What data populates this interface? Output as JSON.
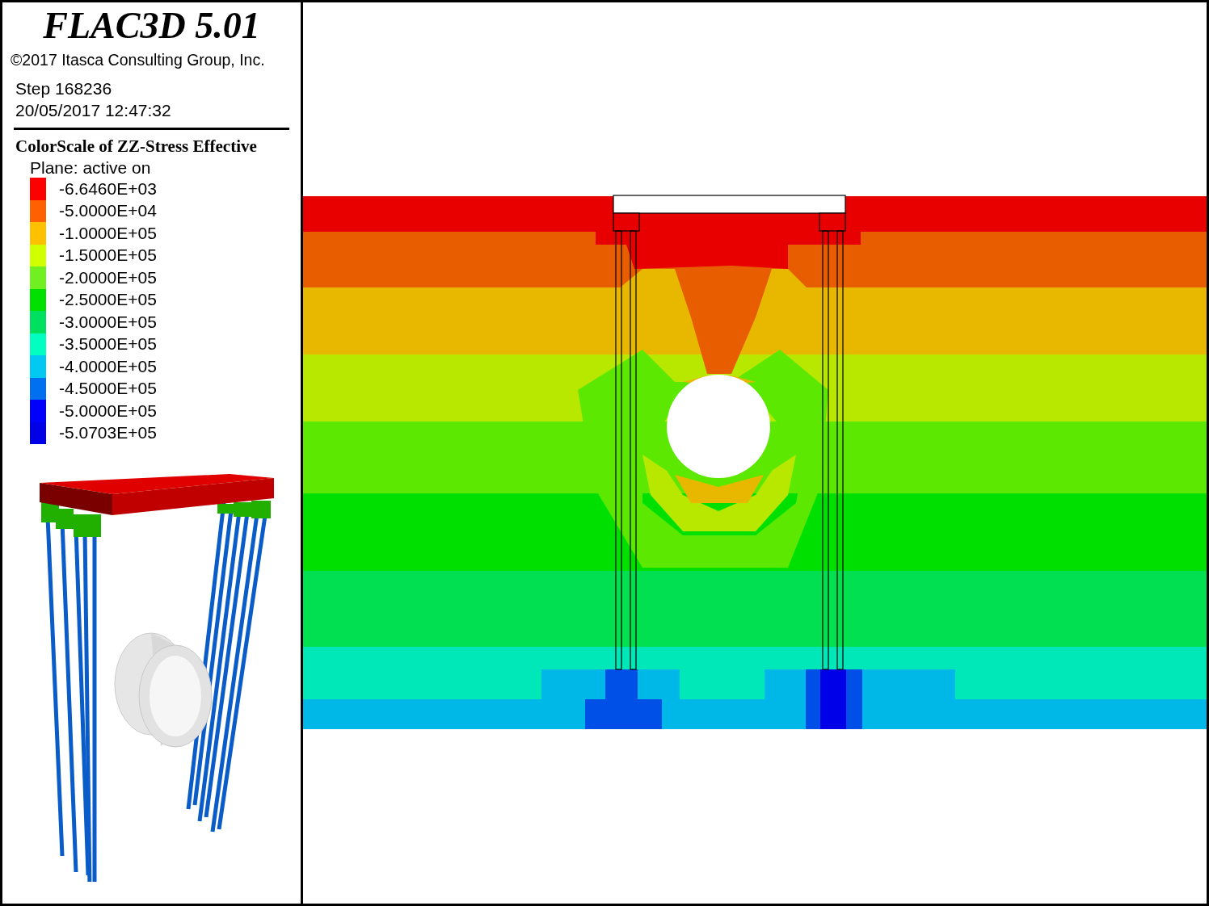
{
  "header": {
    "title": "FLAC3D 5.01",
    "copyright": "©2017 Itasca Consulting Group, Inc.",
    "step": "Step 168236",
    "timestamp": "20/05/2017 12:47:32"
  },
  "legend": {
    "title": "ColorScale of ZZ-Stress Effective",
    "subtitle": "Plane: active on",
    "items": [
      {
        "label": "-6.6460E+03",
        "color": "#ff0000"
      },
      {
        "label": "-5.0000E+04",
        "color": "#ff6000"
      },
      {
        "label": "-1.0000E+05",
        "color": "#ffc000"
      },
      {
        "label": "-1.5000E+05",
        "color": "#d0ff00"
      },
      {
        "label": "-2.0000E+05",
        "color": "#70f020"
      },
      {
        "label": "-2.5000E+05",
        "color": "#00e000"
      },
      {
        "label": "-3.0000E+05",
        "color": "#00e060"
      },
      {
        "label": "-3.5000E+05",
        "color": "#00ffc0"
      },
      {
        "label": "-4.0000E+05",
        "color": "#00c8f0"
      },
      {
        "label": "-4.5000E+05",
        "color": "#0070f0"
      },
      {
        "label": "-5.0000E+05",
        "color": "#0000ff"
      },
      {
        "label": "-5.0703E+05",
        "color": "#0000e8"
      }
    ]
  }
}
